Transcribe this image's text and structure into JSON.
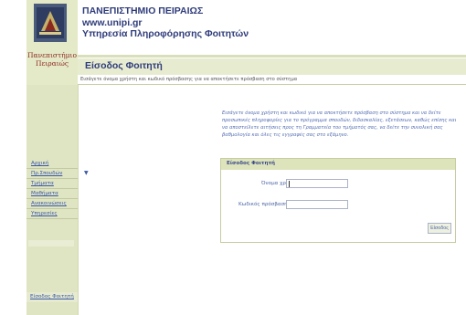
{
  "colors": {
    "sidebar_bg": "#dfe5c2",
    "heading_blue": "#2f3c7a",
    "link_blue": "#3a57a6",
    "brand_red": "#8a2a1e"
  },
  "brand": {
    "logo_line1": "Πανεπιστήμιο",
    "logo_line2": "Πειραιώς",
    "logo_icon": "university-crest"
  },
  "header": {
    "line1": "ΠΑΝΕΠΙΣΤΗΜΙΟ ΠΕΙΡΑΙΩΣ",
    "line2": "www.unipi.gr",
    "line3": "Υπηρεσία Πληροφόρησης Φοιτητών"
  },
  "page": {
    "title": "Είσοδος Φοιτητή",
    "subtitle": "Εισάγετε όνομα χρήστη και κωδικό πρόσβασης για να αποκτήσετε πρόσβαση στο σύστημα",
    "intro": "Εισάγετε όνομα χρήστη και κωδικό για να αποκτήσετε πρόσβαση στο σύστημα και να δείτε προσωπικές πληροφορίες για το πρόγραμμα σπουδών, διδασκαλίας, εξετάσεων, καθώς επίσης και να αποστείλετε αιτήσεις προς τη Γραμματεία του τμήματός σας, να δείτε την συνολική σας βαθμολογία και όλες τις εγγραφές σας στο εξάμηνο."
  },
  "login": {
    "header": "Είσοδος Φοιτητή",
    "username_label": "Όνομα χρήστη:",
    "username_value": "",
    "password_label": "Κωδικός πρόσβασης:",
    "password_value": "",
    "submit_label": "Είσοδος"
  },
  "nav": {
    "items": [
      {
        "label": "Αρχική"
      },
      {
        "label": "Πρ.Σπουδών"
      },
      {
        "label": "Τμήματα"
      },
      {
        "label": "Μαθήματα"
      },
      {
        "label": "Ανακοινώσεις"
      },
      {
        "label": "Υπηρεσίες"
      }
    ],
    "active": "Είσοδος Φοιτητή"
  }
}
